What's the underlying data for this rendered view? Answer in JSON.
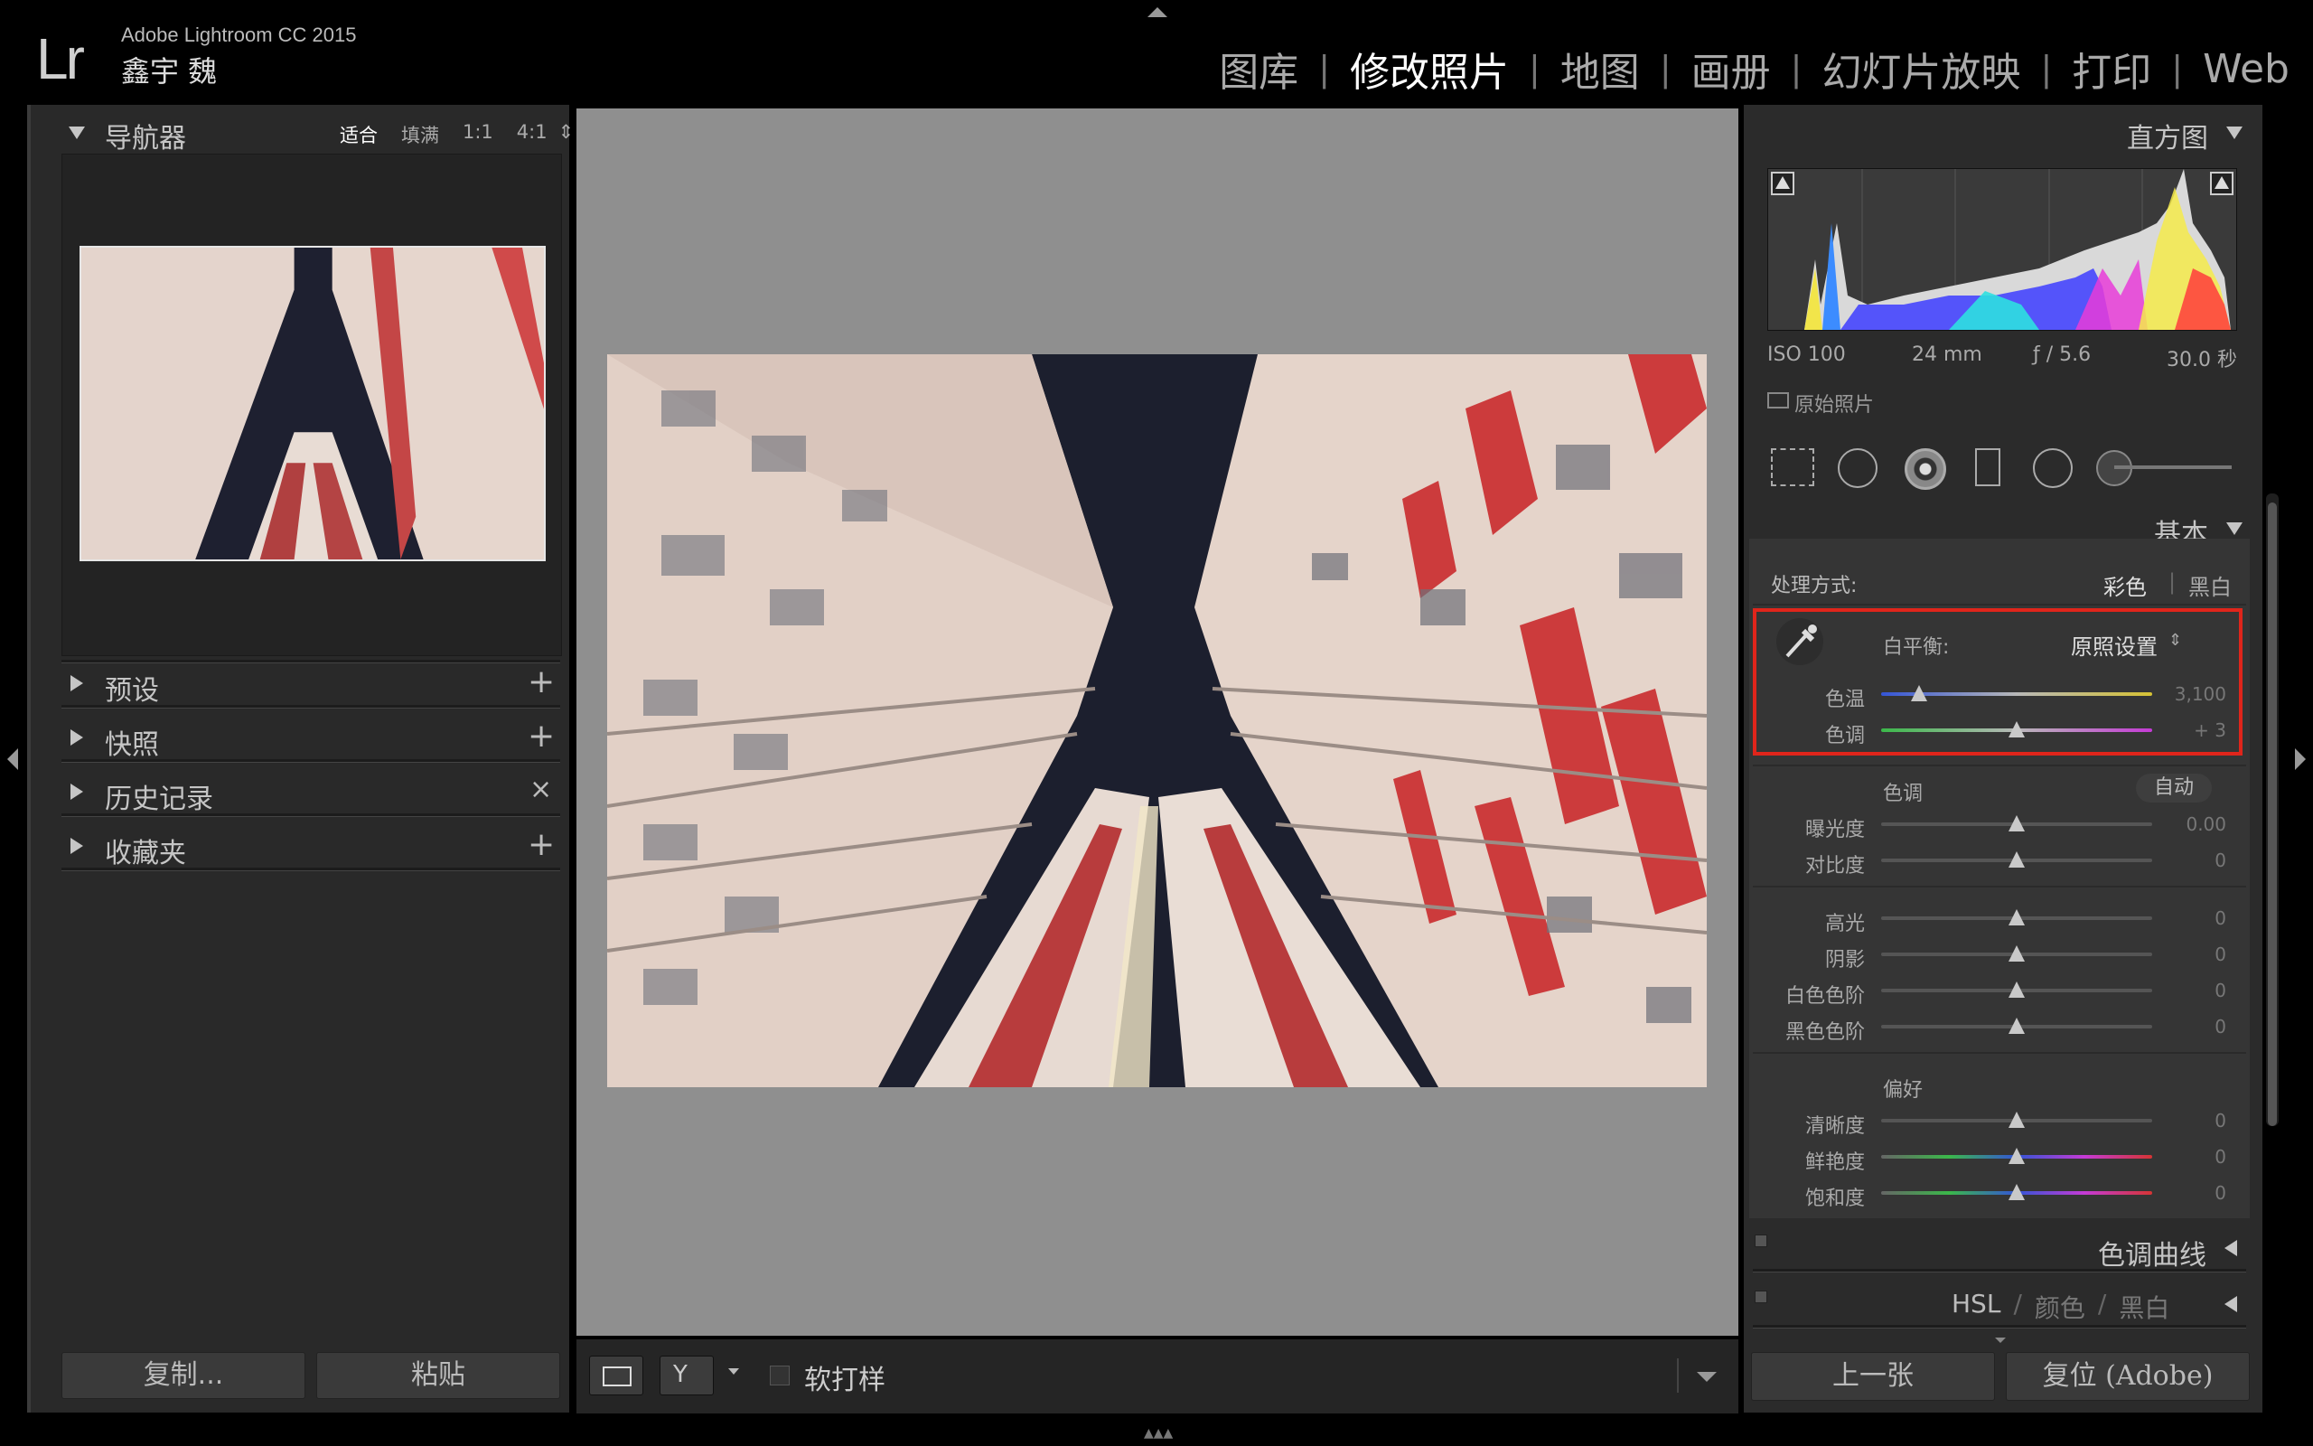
{
  "app": {
    "logo": "Lr",
    "title": "Adobe Lightroom CC 2015",
    "user": "鑫宇 魏"
  },
  "modules": [
    "图库",
    "修改照片",
    "地图",
    "画册",
    "幻灯片放映",
    "打印",
    "Web"
  ],
  "active_module": "修改照片",
  "left_panel": {
    "navigator": {
      "title": "导航器",
      "zoom_options": [
        "适合",
        "填满",
        "1:1",
        "4:1"
      ],
      "zoom_active": "适合"
    },
    "sections": [
      {
        "title": "预设",
        "action": "+"
      },
      {
        "title": "快照",
        "action": "+"
      },
      {
        "title": "历史记录",
        "action": "×"
      },
      {
        "title": "收藏夹",
        "action": "+"
      }
    ],
    "copy_label": "复制...",
    "paste_label": "粘贴"
  },
  "toolbar": {
    "soft_proof_label": "软打样"
  },
  "right_panel": {
    "histogram": {
      "title": "直方图",
      "iso": "ISO 100",
      "focal": "24 mm",
      "aperture": "ƒ / 5.6",
      "shutter": "30.0 秒",
      "original_label": "原始照片"
    },
    "basic": {
      "title": "基本",
      "treatment_label": "处理方式:",
      "treatment_color": "彩色",
      "treatment_bw": "黑白",
      "wb_label": "白平衡:",
      "wb_value": "原照设置",
      "temp": {
        "label": "色温",
        "value": "3,100",
        "level": 0.14
      },
      "tint": {
        "label": "色调",
        "value": "+ 3",
        "level": 0.5
      },
      "tone_title": "色调",
      "auto_label": "自动",
      "exposure": {
        "label": "曝光度",
        "value": "0.00",
        "level": 0.5
      },
      "contrast": {
        "label": "对比度",
        "value": "0",
        "level": 0.5
      },
      "highlights": {
        "label": "高光",
        "value": "0",
        "level": 0.5
      },
      "shadows": {
        "label": "阴影",
        "value": "0",
        "level": 0.5
      },
      "whites": {
        "label": "白色色阶",
        "value": "0",
        "level": 0.5
      },
      "blacks": {
        "label": "黑色色阶",
        "value": "0",
        "level": 0.5
      },
      "presence_title": "偏好",
      "clarity": {
        "label": "清晰度",
        "value": "0",
        "level": 0.5
      },
      "vibrance": {
        "label": "鲜艳度",
        "value": "0",
        "level": 0.5
      },
      "saturation": {
        "label": "饱和度",
        "value": "0",
        "level": 0.5
      }
    },
    "tone_curve_title": "色调曲线",
    "hsl_tabs": [
      "HSL",
      "颜色",
      "黑白"
    ],
    "hsl_sep": "/",
    "prev_label": "上一张",
    "reset_label": "复位 (Adobe)"
  },
  "colors": {
    "highlight_box": "#e0251b",
    "panel_bg": "#2b2b2b",
    "canvas_bg": "#8f8f8f"
  }
}
